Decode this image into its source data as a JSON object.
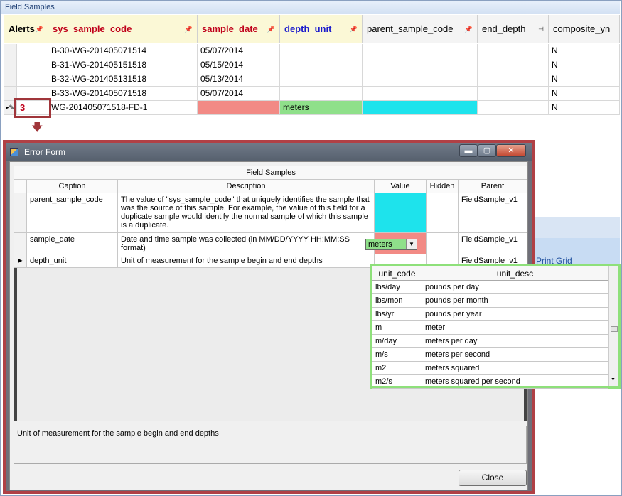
{
  "panel": {
    "title": "Field Samples"
  },
  "grid": {
    "columns": [
      {
        "label": "Alerts",
        "color": "#000000",
        "underline": false
      },
      {
        "label": "sys_sample_code",
        "color": "#c0001a",
        "underline": true
      },
      {
        "label": "sample_date",
        "color": "#c0001a",
        "underline": false
      },
      {
        "label": "depth_unit",
        "color": "#1a1acc",
        "underline": false
      },
      {
        "label": "parent_sample_code",
        "color": "#000000",
        "underline": false
      },
      {
        "label": "end_depth",
        "color": "#000000",
        "underline": false
      },
      {
        "label": "composite_yn",
        "color": "#000000",
        "underline": false
      }
    ],
    "rows": [
      {
        "alerts": "",
        "sys_sample_code": "B-30-WG-201405071514",
        "sample_date": "05/07/2014",
        "depth_unit": "",
        "parent_sample_code": "",
        "end_depth": "",
        "composite_yn": "N"
      },
      {
        "alerts": "",
        "sys_sample_code": "B-31-WG-201405151518",
        "sample_date": "05/15/2014",
        "depth_unit": "",
        "parent_sample_code": "",
        "end_depth": "",
        "composite_yn": "N"
      },
      {
        "alerts": "",
        "sys_sample_code": "B-32-WG-201405131518",
        "sample_date": "05/13/2014",
        "depth_unit": "",
        "parent_sample_code": "",
        "end_depth": "",
        "composite_yn": "N"
      },
      {
        "alerts": "",
        "sys_sample_code": "B-33-WG-201405071518",
        "sample_date": "05/07/2014",
        "depth_unit": "",
        "parent_sample_code": "",
        "end_depth": "",
        "composite_yn": "N"
      },
      {
        "alerts": "3",
        "sys_sample_code": "WG-201405071518-FD-1",
        "sample_date": "",
        "depth_unit": "meters",
        "parent_sample_code": "",
        "end_depth": "",
        "composite_yn": "N"
      }
    ],
    "error_colors": {
      "sample_date": "#f28a85",
      "depth_unit": "#8fe08a",
      "parent_sample_code": "#1ee3ec"
    }
  },
  "error_form": {
    "title": "Error Form",
    "window_buttons": {
      "minimize": "▬",
      "maximize": "▢",
      "close": "✕"
    },
    "group_header": "Field Samples",
    "columns": [
      "Caption",
      "Description",
      "Value",
      "Hidden",
      "Parent"
    ],
    "rows": [
      {
        "caption": "parent_sample_code",
        "description": "The value of \"sys_sample_code\" that uniquely identifies the sample that was the source of this sample. For example, the value of this field for a duplicate sample would identify the normal sample of which this sample is a duplicate.",
        "value": "",
        "hidden": "",
        "parent": "FieldSample_v1",
        "value_color": "#1ee3ec"
      },
      {
        "caption": "sample_date",
        "description": "Date and time sample was collected (in MM/DD/YYYY HH:MM:SS format)",
        "value": "",
        "hidden": "",
        "parent": "FieldSample_v1",
        "value_color": "#f28a85"
      },
      {
        "caption": "depth_unit",
        "description": "Unit of measurement for the sample begin and end depths",
        "value": "meters",
        "hidden": "",
        "parent": "FieldSample_v1",
        "value_color": "#8fe08a"
      }
    ],
    "status_description": "Unit of measurement for the sample begin and end depths",
    "close_label": "Close"
  },
  "dropdown": {
    "columns": [
      "unit_code",
      "unit_desc"
    ],
    "items": [
      {
        "code": "lbs/day",
        "desc": "pounds per day"
      },
      {
        "code": "lbs/mon",
        "desc": "pounds per month"
      },
      {
        "code": "lbs/yr",
        "desc": "pounds per year"
      },
      {
        "code": "m",
        "desc": "meter"
      },
      {
        "code": "m/day",
        "desc": "meters per day"
      },
      {
        "code": "m/s",
        "desc": "meters per second"
      },
      {
        "code": "m2",
        "desc": "meters squared"
      },
      {
        "code": "m2/s",
        "desc": "meters squared per second"
      }
    ]
  },
  "background": {
    "print_grid_label": "Print Grid"
  }
}
